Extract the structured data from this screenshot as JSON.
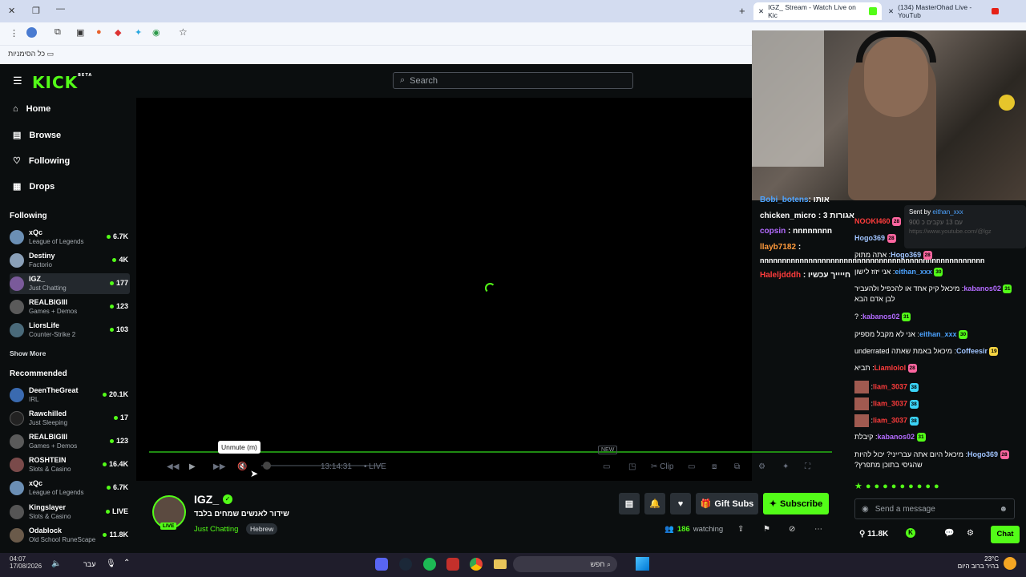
{
  "browser": {
    "tabs": [
      {
        "label": "IGZ_ Stream - Watch Live on Kic",
        "active": true
      },
      {
        "label": "(134) MasterOhad Live - YouTub",
        "active": false
      }
    ],
    "bookmarks_label": "כל הסימניות"
  },
  "header": {
    "logo": "KICK",
    "logo_badge": "BETA",
    "search_placeholder": "Search"
  },
  "nav": [
    {
      "label": "Home",
      "icon": "home-icon"
    },
    {
      "label": "Browse",
      "icon": "browse-icon"
    },
    {
      "label": "Following",
      "icon": "heart-icon"
    },
    {
      "label": "Drops",
      "icon": "drops-icon"
    }
  ],
  "following_title": "Following",
  "following": [
    {
      "name": "xQc",
      "category": "League of Legends",
      "viewers": "6.7K",
      "color": "#6b8fb5"
    },
    {
      "name": "Destiny",
      "category": "Factorio",
      "viewers": "4K",
      "color": "#8aa0b8"
    },
    {
      "name": "IGZ_",
      "category": "Just Chatting",
      "viewers": "177",
      "color": "#7a5a9a"
    },
    {
      "name": "REALBIGIII",
      "category": "Games + Demos",
      "viewers": "123",
      "color": "#5a5a5a"
    },
    {
      "name": "LiorsLife",
      "category": "Counter-Strike 2",
      "viewers": "103",
      "color": "#4a6a7a"
    }
  ],
  "show_more": "Show More",
  "recommended_title": "Recommended",
  "recommended": [
    {
      "name": "DeenTheGreat",
      "category": "IRL",
      "viewers": "20.1K",
      "color": "#3a6ab0"
    },
    {
      "name": "Rawchilled",
      "category": "Just Sleeping",
      "viewers": "17",
      "color": "#222"
    },
    {
      "name": "REALBIGIII",
      "category": "Games + Demos",
      "viewers": "123",
      "color": "#5a5a5a"
    },
    {
      "name": "ROSHTEIN",
      "category": "Slots & Casino",
      "viewers": "16.4K",
      "color": "#7a4a4a"
    },
    {
      "name": "xQc",
      "category": "League of Legends",
      "viewers": "6.7K",
      "color": "#6b8fb5"
    },
    {
      "name": "Kingslayer",
      "category": "Slots & Casino",
      "viewers": "LIVE",
      "color": "#555"
    },
    {
      "name": "Odablock",
      "category": "Old School RuneScape",
      "viewers": "11.8K",
      "color": "#6a5a4a"
    }
  ],
  "player": {
    "tooltip": "Unmute (m)",
    "time": "13:14:31",
    "live": "LIVE",
    "new_badge": "NEW",
    "clip": "Clip"
  },
  "stream": {
    "name": "IGZ_",
    "title": "שידור לאנשים שמחים בלבד",
    "category": "Just Chatting",
    "tag": "Hebrew",
    "live_badge": "LIVE",
    "watching_count": "186",
    "watching_label": "watching",
    "gift_subs": "Gift Subs",
    "subscribe": "Subscribe"
  },
  "overlay_chat": [
    {
      "user": "Bobi_botens",
      "text": ": אותו",
      "color": "#4da3ff"
    },
    {
      "user": "chicken_micro",
      "text": ": 3 אגורות",
      "color": "#ffffff"
    },
    {
      "user": "copsin",
      "text": ": nnnnnnnn",
      "color": "#b36bff"
    },
    {
      "user": "llayb7182",
      "text": ":",
      "color": "#ff9a3c"
    },
    {
      "user": "",
      "text": "nnnnnnnnnnnnnnnnnnnnnnnnnnnnnnnnnnnnnnnnnnnnnnnnnnn",
      "color": "#ffffff"
    },
    {
      "user": "Haleljdddh",
      "text": ": חייייך עכשיו",
      "color": "#ff3c3c"
    }
  ],
  "sent_by": {
    "label": "Sent by",
    "user": "eithan_xxx",
    "line2": "900 עם 13 עקבים כ",
    "link": "https://www.youtube.com/@lgz"
  },
  "chat": [
    {
      "user": "NOOKI460",
      "text": "",
      "color": "#ff3c3c",
      "badge": "28"
    },
    {
      "user": "Hogo369",
      "text": "",
      "color": "#a0c4ff",
      "badge": "28"
    },
    {
      "user": "Hogo369",
      "text": "אתה מתוק",
      "color": "#a0c4ff",
      "badge": "28"
    },
    {
      "user": "eithan_xxx",
      "text": "אני יזוז לישון",
      "color": "#4da3ff",
      "badge": "30"
    },
    {
      "user": "kabanos02",
      "text": "מיכאל קיק אחד או להכפיל ולהעביר לבן אדם הבא",
      "color": "#b36bff",
      "badge": "31"
    },
    {
      "user": "kabanos02",
      "text": "?",
      "color": "#b36bff",
      "badge": "31"
    },
    {
      "user": "eithan_xxx",
      "text": "אני לא מקבל מספיק",
      "color": "#4da3ff",
      "badge": "30"
    },
    {
      "user": "Coffeesir",
      "text": "מיכאל באמת שאתה underrated",
      "color": "#a0c4ff",
      "badge": "19"
    },
    {
      "user": "Liamlolol",
      "text": "תביא",
      "color": "#ff3c3c",
      "badge": "28"
    },
    {
      "user": "liam_3037",
      "text": "",
      "color": "#ff3c3c",
      "badge": "38"
    },
    {
      "user": "liam_3037",
      "text": "",
      "color": "#ff3c3c",
      "badge": "38"
    },
    {
      "user": "liam_3037",
      "text": "",
      "color": "#ff3c3c",
      "badge": "38"
    },
    {
      "user": "kabanos02",
      "text": "קיבלת",
      "color": "#b36bff",
      "badge": "31"
    },
    {
      "user": "Hogo369",
      "text": "מיכאל היום אתה עברייני? יכול להיות שהגיסי בתוכן מתפרץ?",
      "color": "#a0c4ff",
      "badge": "28"
    }
  ],
  "chat_input_placeholder": "Send a message",
  "chat_footer": {
    "count": "11.8K",
    "chat_button": "Chat"
  },
  "taskbar": {
    "time": "04:07",
    "date": "17/08/2026",
    "lang": "עבר",
    "search": "חפש",
    "weather_temp": "23°C",
    "weather_desc": "בהיר ברוב היום"
  },
  "colors": {
    "accent": "#53fc18",
    "bg": "#0b0e0f"
  }
}
